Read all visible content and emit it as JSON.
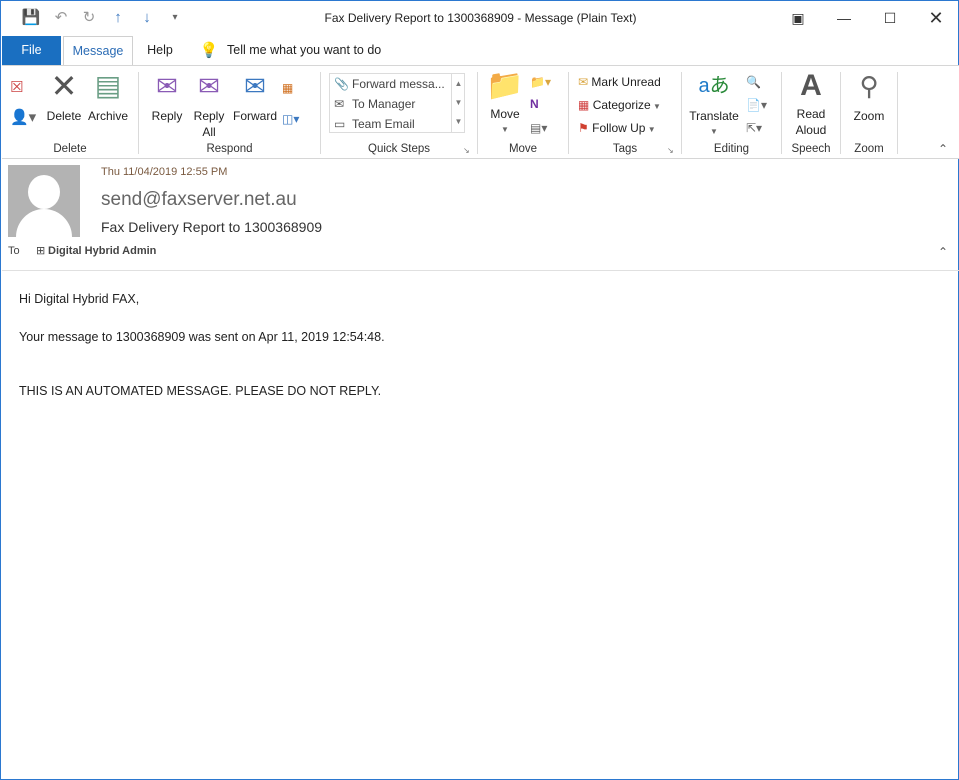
{
  "window": {
    "title": "Fax Delivery Report to 1300368909  -  Message (Plain Text)"
  },
  "qat": {
    "save": "save-icon",
    "undo": "undo-icon",
    "redo": "redo-icon",
    "up": "up-arrow-icon",
    "down": "down-arrow-icon",
    "customize": "customize-icon"
  },
  "tabs": {
    "file": "File",
    "message": "Message",
    "help": "Help",
    "tell_me": "Tell me what you want to do"
  },
  "ribbon": {
    "delete_group": {
      "label": "Delete",
      "delete": "Delete",
      "archive": "Archive"
    },
    "respond_group": {
      "label": "Respond",
      "reply": "Reply",
      "reply_all_1": "Reply",
      "reply_all_2": "All",
      "forward": "Forward"
    },
    "quick_steps": {
      "label": "Quick Steps",
      "items": [
        "Forward messa...",
        "To Manager",
        "Team Email"
      ]
    },
    "move_group": {
      "label": "Move",
      "move": "Move"
    },
    "tags_group": {
      "label": "Tags",
      "mark_unread": "Mark Unread",
      "categorize": "Categorize",
      "follow_up": "Follow Up"
    },
    "editing_group": {
      "label": "Editing",
      "translate": "Translate"
    },
    "speech_group": {
      "label": "Speech",
      "read_1": "Read",
      "read_2": "Aloud"
    },
    "zoom_group": {
      "label": "Zoom",
      "zoom": "Zoom"
    }
  },
  "message": {
    "date": "Thu 11/04/2019 12:55 PM",
    "from": "send@faxserver.net.au",
    "subject": "Fax Delivery Report to 1300368909",
    "to_label": "To",
    "to": "Digital Hybrid Admin",
    "body": [
      "Hi Digital Hybrid FAX,",
      "Your message to 1300368909 was sent on Apr 11, 2019 12:54:48.",
      "THIS IS AN AUTOMATED MESSAGE. PLEASE DO NOT REPLY."
    ]
  },
  "colors": {
    "accent": "#1a6fc1",
    "window_border": "#2b78d0"
  }
}
